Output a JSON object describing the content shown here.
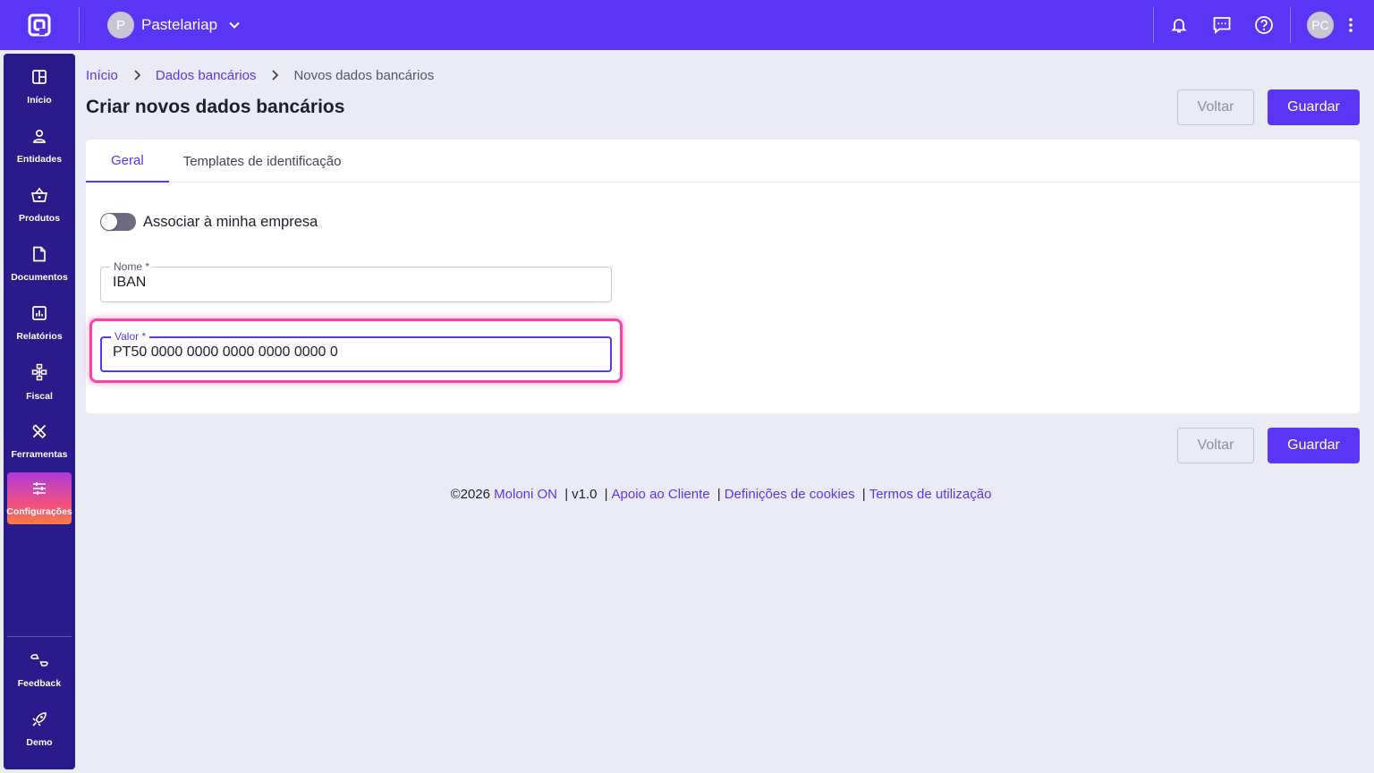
{
  "topbar": {
    "company_initial": "P",
    "company_name": "Pastelariap",
    "user_initials": "PC",
    "icons": [
      "logo-icon",
      "chevron-down-icon",
      "bell-icon",
      "chat-icon",
      "help-icon",
      "more-vertical-icon"
    ]
  },
  "sidebar": {
    "items": [
      {
        "label": "Início",
        "icon": "home-grid-icon"
      },
      {
        "label": "Entidades",
        "icon": "user-icon"
      },
      {
        "label": "Produtos",
        "icon": "basket-icon"
      },
      {
        "label": "Documentos",
        "icon": "document-icon"
      },
      {
        "label": "Relatórios",
        "icon": "chart-icon"
      },
      {
        "label": "Fiscal",
        "icon": "fiscal-icon"
      },
      {
        "label": "Ferramentas",
        "icon": "tools-icon"
      },
      {
        "label": "Configurações",
        "icon": "sliders-icon"
      }
    ],
    "bottom": [
      {
        "label": "Feedback",
        "icon": "feedback-icon"
      },
      {
        "label": "Demo",
        "icon": "rocket-icon"
      }
    ],
    "accent_gradient": [
      "#b03ad8",
      "#f04f82",
      "#fb7a45"
    ]
  },
  "breadcrumb": {
    "home": "Início",
    "section": "Dados bancários",
    "current": "Novos dados bancários"
  },
  "page_title": "Criar novos dados bancários",
  "actions": {
    "back": "Voltar",
    "save": "Guardar"
  },
  "tabs": [
    {
      "label": "Geral",
      "active": true
    },
    {
      "label": "Templates de identificação",
      "active": false
    }
  ],
  "form": {
    "toggle_label": "Associar à minha empresa",
    "toggle_on": false,
    "name_label": "Nome *",
    "name_value": "IBAN",
    "value_label": "Valor *",
    "value_value": "PT50 0000 0000 0000 0000 0000 0"
  },
  "footer": {
    "copyright": "©2026",
    "brand": "Moloni ON",
    "version": "v1.0",
    "support": "Apoio ao Cliente",
    "cookies": "Definições de cookies",
    "terms": "Termos de utilização",
    "separator": "|"
  },
  "colors": {
    "primary": "#5a35f5",
    "sidebar": "#2a1a8a",
    "background": "#ebebf6",
    "highlight": "#ff3fa4"
  }
}
